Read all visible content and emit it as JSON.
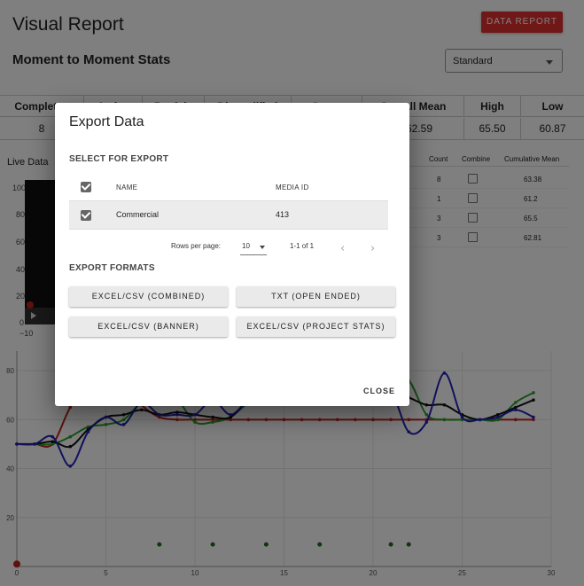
{
  "header": {
    "title": "Visual Report",
    "data_report_label": "DATA REPORT",
    "subtitle": "Moment to Moment Stats"
  },
  "view_select": {
    "value": "Standard"
  },
  "stats_table": {
    "headers": [
      "Completes",
      "Active",
      "Partials",
      "Disqualified",
      "Quota",
      "Overall Mean",
      "High",
      "Low"
    ],
    "values": [
      "8",
      "",
      "",
      "",
      "",
      "62.59",
      "65.50",
      "60.87"
    ]
  },
  "live_data": {
    "label": "Live Data",
    "y_ticks": [
      "100",
      "80",
      "60",
      "40",
      "20",
      "0",
      "−10"
    ]
  },
  "segments_table": {
    "headers": {
      "count": "Count",
      "combine": "Combine",
      "cumulative": "Cumulative Mean"
    },
    "rows": [
      {
        "count": "8",
        "cumulative": "63.38"
      },
      {
        "count": "1",
        "cumulative": "61.2"
      },
      {
        "count": "3",
        "cumulative": "65.5"
      },
      {
        "count": "3",
        "cumulative": "62.81"
      }
    ]
  },
  "dialog": {
    "title": "Export Data",
    "select_label": "SELECT FOR EXPORT",
    "col_name": "NAME",
    "col_media": "MEDIA ID",
    "row": {
      "name": "Commercial",
      "media_id": "413"
    },
    "rows_per_page_label": "Rows per page:",
    "rows_per_page_value": "10",
    "page_range": "1-1 of 1",
    "formats_label": "EXPORT FORMATS",
    "btn_excel_combined": "EXCEL/CSV (COMBINED)",
    "btn_txt": "TXT (OPEN ENDED)",
    "btn_excel_banner": "EXCEL/CSV (BANNER)",
    "btn_excel_project": "EXCEL/CSV (PROJECT STATS)",
    "close_label": "CLOSE"
  },
  "chart_data": {
    "type": "line",
    "x_ticks": [
      "0",
      "5",
      "10",
      "15",
      "20",
      "25",
      "30"
    ],
    "y_ticks": [
      "20",
      "40",
      "60",
      "80"
    ],
    "xlim": [
      0,
      30
    ],
    "ylim": [
      0,
      88
    ],
    "grid": true,
    "colors": {
      "red": "#c0231e",
      "green": "#2ca02c",
      "black": "#111111",
      "blue": "#2222bb",
      "dots": "#1a6e1a"
    },
    "series": [
      {
        "color": "red",
        "x": [
          0,
          1,
          2,
          3,
          4,
          5,
          6,
          7,
          8,
          9,
          10,
          11,
          12,
          13,
          14,
          15,
          16,
          17,
          18,
          19,
          20,
          21,
          22,
          23,
          24,
          25,
          26,
          27,
          28,
          29
        ],
        "values": [
          50,
          50,
          50,
          65,
          74,
          82,
          75,
          66,
          61,
          60,
          60,
          60,
          60,
          60,
          60,
          60,
          60,
          60,
          60,
          60,
          60,
          60,
          60,
          60,
          60,
          60,
          60,
          60,
          60,
          60
        ]
      },
      {
        "color": "green",
        "x": [
          0,
          1,
          2,
          3,
          4,
          5,
          6,
          7,
          8,
          9,
          10,
          11,
          12,
          13,
          14,
          15,
          16,
          17,
          18,
          19,
          20,
          21,
          22,
          23,
          24,
          25,
          26,
          27,
          28,
          29
        ],
        "values": [
          50,
          50,
          50,
          53,
          57,
          58,
          60,
          67,
          69,
          68,
          59,
          59,
          61,
          67,
          72,
          75,
          75,
          79,
          73,
          74,
          74,
          76,
          76,
          62,
          60,
          60,
          60,
          60,
          67,
          71
        ]
      },
      {
        "color": "black",
        "x": [
          0,
          1,
          2,
          3,
          4,
          5,
          6,
          7,
          8,
          9,
          10,
          11,
          12,
          13,
          14,
          15,
          16,
          17,
          18,
          19,
          20,
          21,
          22,
          23,
          24,
          25,
          26,
          27,
          28,
          29
        ],
        "values": [
          50,
          50,
          51,
          49,
          56,
          61,
          62,
          64,
          62,
          63,
          62,
          61,
          61,
          68,
          71,
          72,
          72,
          71,
          70,
          70,
          70,
          71,
          69,
          66,
          66,
          62,
          60,
          62,
          65,
          68
        ]
      },
      {
        "color": "blue",
        "x": [
          0,
          1,
          2,
          3,
          4,
          5,
          6,
          7,
          8,
          9,
          10,
          11,
          12,
          13,
          14,
          15,
          16,
          17,
          18,
          19,
          20,
          21,
          22,
          23,
          24,
          25,
          26,
          27,
          28,
          29
        ],
        "values": [
          50,
          50,
          53,
          41,
          55,
          61,
          58,
          67,
          62,
          62,
          62,
          68,
          62,
          68,
          70,
          72,
          72,
          68,
          71,
          73,
          73,
          72,
          55,
          59,
          79,
          61,
          60,
          61,
          64,
          61
        ]
      },
      {
        "color": "dots",
        "x": [
          8,
          11,
          14,
          17,
          21,
          22
        ],
        "values": [
          9,
          9,
          9,
          9,
          9,
          9
        ]
      }
    ],
    "red_start_marker": {
      "x": 0,
      "y": 1
    }
  }
}
